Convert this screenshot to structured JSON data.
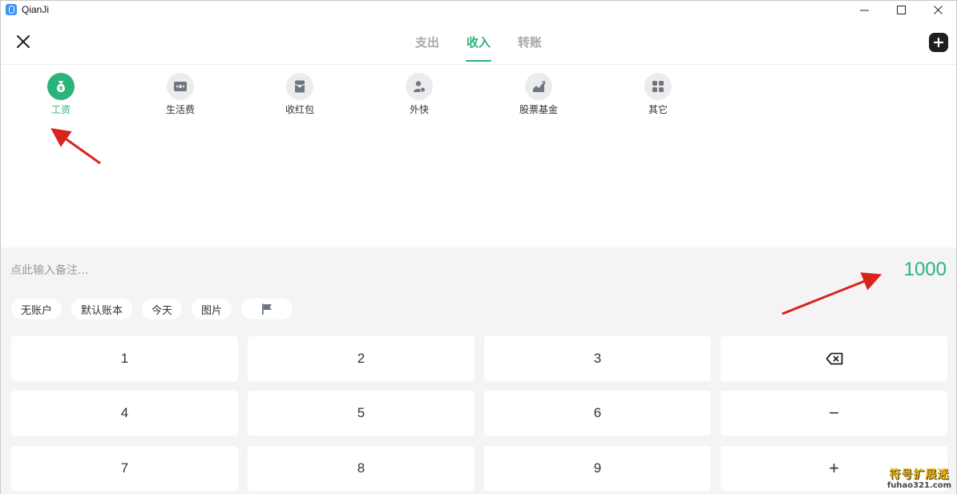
{
  "window": {
    "title": "QianJi"
  },
  "header": {
    "tabs": [
      {
        "label": "支出",
        "active": false
      },
      {
        "label": "收入",
        "active": true
      },
      {
        "label": "转账",
        "active": false
      }
    ]
  },
  "categories": [
    {
      "label": "工资",
      "icon": "money-bag-icon",
      "selected": true
    },
    {
      "label": "生活费",
      "icon": "wallet-icon",
      "selected": false
    },
    {
      "label": "收红包",
      "icon": "red-envelope-icon",
      "selected": false
    },
    {
      "label": "外快",
      "icon": "person-coin-icon",
      "selected": false
    },
    {
      "label": "股票基金",
      "icon": "stock-chart-icon",
      "selected": false
    },
    {
      "label": "其它",
      "icon": "grid-icon",
      "selected": false
    }
  ],
  "entry": {
    "note_placeholder": "点此输入备注...",
    "amount": "1000"
  },
  "chips": {
    "account": "无账户",
    "book": "默认账本",
    "date": "今天",
    "image": "图片",
    "flag_icon": "flag-icon"
  },
  "keypad": {
    "keys": [
      "1",
      "2",
      "3",
      "4",
      "5",
      "6",
      "7",
      "8",
      "9"
    ],
    "backspace_icon": "backspace-icon",
    "minus": "−",
    "plus": "+"
  },
  "colors": {
    "accent": "#2bb47a",
    "annotation_arrow": "#d9241c"
  },
  "watermark": {
    "title": "符号扩展迷",
    "url": "fuhao321.com"
  }
}
